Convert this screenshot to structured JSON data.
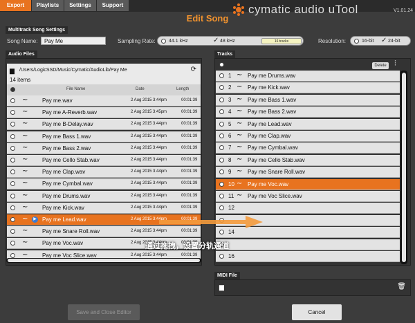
{
  "tabs": [
    {
      "label": "Export",
      "active": true
    },
    {
      "label": "Playlists",
      "active": false
    },
    {
      "label": "Settings",
      "active": false
    },
    {
      "label": "Support",
      "active": false
    }
  ],
  "brand": {
    "name": "cymatic audio uTool",
    "version": "V1.01.24"
  },
  "page_title": "Edit Song",
  "multitrack": {
    "section_label": "Multitrack Song Settings",
    "song_name_label": "Song Name:",
    "song_name_value": "Pay Me",
    "sampling_rate_label": "Sampling Rate:",
    "sampling_options": [
      "44.1 kHz",
      "48 kHz"
    ],
    "sampling_selected": "48 kHz",
    "tracks_badge": "16 tracks",
    "resolution_label": "Resolution:",
    "resolution_options": [
      "16-bit",
      "24-bit"
    ],
    "resolution_selected": "24-bit"
  },
  "audio_files": {
    "section_label": "Audio Files",
    "path": "/Users/LogicSSD/Music/Cymatic/AudioLib/Pay Me",
    "count": "14 items",
    "columns": {
      "name": "File Name",
      "date": "Date",
      "length": "Length"
    },
    "files": [
      {
        "name": "Pay me.wav",
        "date": "2 Aug 2015 3:44pm",
        "length": "00:01:39"
      },
      {
        "name": "Pay me A-Reverb.wav",
        "date": "2 Aug 2015 3:45pm",
        "length": "00:01:39"
      },
      {
        "name": "Pay me B-Delay.wav",
        "date": "2 Aug 2015 3:44pm",
        "length": "00:01:39"
      },
      {
        "name": "Pay me Bass 1.wav",
        "date": "2 Aug 2015 3:44pm",
        "length": "00:01:39"
      },
      {
        "name": "Pay me Bass 2.wav",
        "date": "2 Aug 2015 3:44pm",
        "length": "00:01:39"
      },
      {
        "name": "Pay me Cello Stab.wav",
        "date": "2 Aug 2015 3:44pm",
        "length": "00:01:39"
      },
      {
        "name": "Pay me Clap.wav",
        "date": "2 Aug 2015 3:44pm",
        "length": "00:01:39"
      },
      {
        "name": "Pay me Cymbal.wav",
        "date": "2 Aug 2015 3:44pm",
        "length": "00:01:39"
      },
      {
        "name": "Pay me Drums.wav",
        "date": "2 Aug 2015 3:44pm",
        "length": "00:01:39"
      },
      {
        "name": "Pay me Kick.wav",
        "date": "2 Aug 2015 3:44pm",
        "length": "00:01:39"
      },
      {
        "name": "Pay me Lead.wav",
        "date": "2 Aug 2015 3:44pm",
        "length": "00:01:39",
        "selected": true
      },
      {
        "name": "Pay me Snare Roll.wav",
        "date": "2 Aug 2015 3:44pm",
        "length": "00:01:39"
      },
      {
        "name": "Pay me Voc.wav",
        "date": "2 Aug 2015 3:44pm",
        "length": "00:01:39"
      },
      {
        "name": "Pay me Voc Slice.wav",
        "date": "2 Aug 2015 3:44pm",
        "length": "00:01:39"
      }
    ]
  },
  "tracks": {
    "section_label": "Tracks",
    "delete_label": "Delete",
    "items": [
      {
        "num": "1",
        "name": "Pay me Drums.wav"
      },
      {
        "num": "2",
        "name": "Pay me Kick.wav"
      },
      {
        "num": "3",
        "name": "Pay me Bass 1.wav"
      },
      {
        "num": "4",
        "name": "Pay me Bass 2.wav"
      },
      {
        "num": "5",
        "name": "Pay me Lead.wav"
      },
      {
        "num": "6",
        "name": "Pay me Clap.wav"
      },
      {
        "num": "7",
        "name": "Pay me Cymbal.wav"
      },
      {
        "num": "8",
        "name": "Pay me Cello Stab.wav"
      },
      {
        "num": "9",
        "name": "Pay me Snare Roll.wav"
      },
      {
        "num": "10",
        "name": "Pay me Voc.wav",
        "selected": true
      },
      {
        "num": "11",
        "name": "Pay me Voc Slice.wav"
      },
      {
        "num": "12",
        "name": ""
      },
      {
        "num": "",
        "name": ""
      },
      {
        "num": "14",
        "name": ""
      },
      {
        "num": "",
        "name": ""
      },
      {
        "num": "16",
        "name": ""
      }
    ]
  },
  "midi": {
    "section_label": "MIDI File"
  },
  "buttons": {
    "save_close": "Save and Close Editor",
    "cancel": "Cancel"
  },
  "overlay_caption": "通过拖拽，设置分轨通道",
  "colors": {
    "accent": "#e8731f",
    "background": "#3c3c3c"
  }
}
